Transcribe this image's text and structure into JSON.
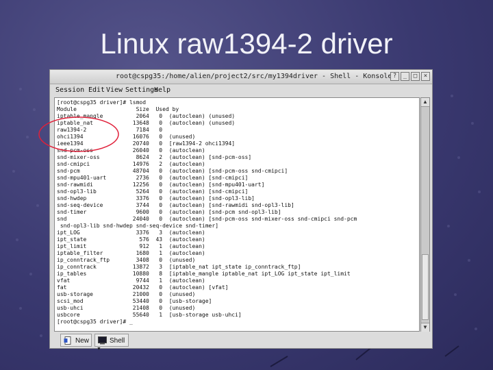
{
  "slide": {
    "title": "Linux raw1394-2 driver"
  },
  "window": {
    "title": "root@cspg35:/home/alien/project2/src/my1394driver - Shell - Konsole",
    "controls": [
      "?",
      "_",
      "□",
      "×"
    ]
  },
  "menu": [
    "Session",
    "Edit",
    "View",
    "Settings",
    "Help"
  ],
  "terminal": {
    "lines": [
      "[root@cspg35 driver]# lsmod",
      "Module                  Size  Used by",
      "iptable_mangle          2064   0  (autoclean) (unused)",
      "iptable_nat            13648   0  (autoclean) (unused)",
      "raw1394-2               7184   0",
      "ohci1394               16076   0  (unused)",
      "ieee1394               20740   0  [raw1394-2 ohci1394]",
      "snd-pcm-oss            26040   0  (autoclean)",
      "snd-mixer-oss           8624   2  (autoclean) [snd-pcm-oss]",
      "snd-cmipci             14976   2  (autoclean)",
      "snd-pcm                48704   0  (autoclean) [snd-pcm-oss snd-cmipci]",
      "snd-mpu401-uart         2736   0  (autoclean) [snd-cmipci]",
      "snd-rawmidi            12256   0  (autoclean) [snd-mpu401-uart]",
      "snd-opl3-lib            5264   0  (autoclean) [snd-cmipci]",
      "snd-hwdep               3376   0  (autoclean) [snd-opl3-lib]",
      "snd-seq-device          3744   0  (autoclean) [snd-rawmidi snd-opl3-lib]",
      "snd-timer               9600   0  (autoclean) [snd-pcm snd-opl3-lib]",
      "snd                    24040   0  (autoclean) [snd-pcm-oss snd-mixer-oss snd-cmipci snd-pcm",
      " snd-opl3-lib snd-hwdep snd-seq-device snd-timer]",
      "ipt_LOG                 3376   3  (autoclean)",
      "ipt_state                576  43  (autoclean)",
      "ipt_limit                912   1  (autoclean)",
      "iptable_filter          1680   1  (autoclean)",
      "ip_conntrack_ftp        3408   0  (unused)",
      "ip_conntrack           13872   3  [iptable_nat ipt_state ip_conntrack_ftp]",
      "ip_tables              10880   8  [iptable_mangle iptable_nat ipt_LOG ipt_state ipt_limit",
      "vfat                    9744   1  (autoclean)",
      "fat                    20432   0  (autoclean) [vfat]",
      "usb-storage            21000   0  (unused)",
      "scsi_mod               53440   0  [usb-storage]",
      "usb-uhci               21408   0  (unused)",
      "usbcore                55640   1  [usb-storage usb-uhci]",
      "[root@cspg35 driver]# _"
    ]
  },
  "tabs": {
    "new_label": "New",
    "shell_label": "Shell"
  }
}
